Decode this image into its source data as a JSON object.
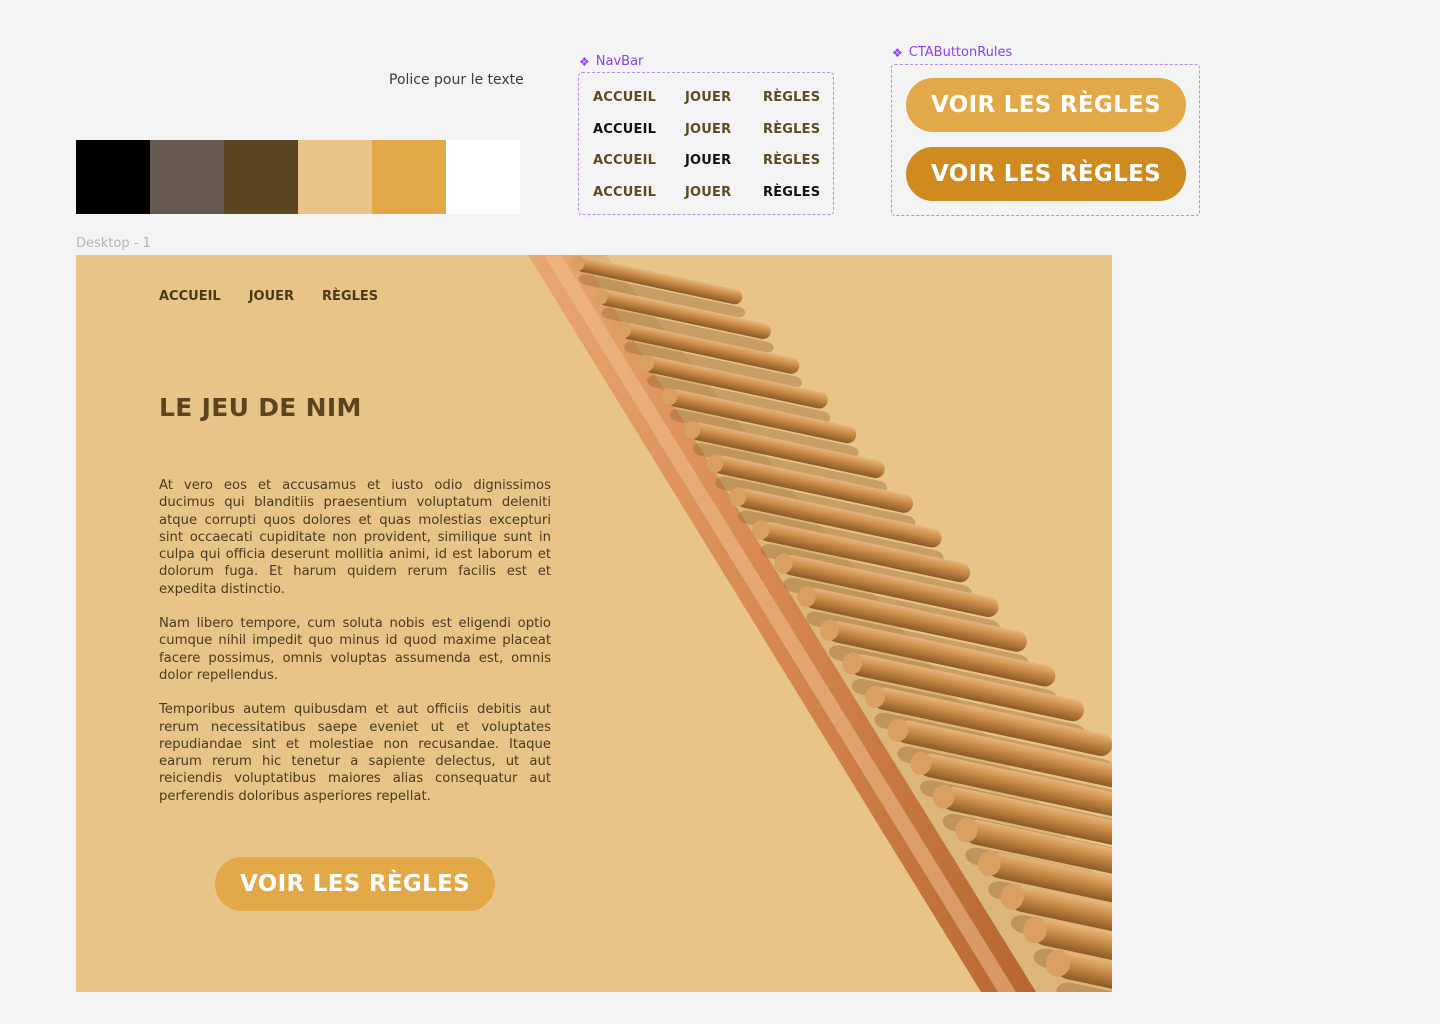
{
  "styleguide": {
    "font_note": "Police pour le texte",
    "palette": [
      "#000000",
      "#655a4f",
      "#5b4520",
      "#e8c488",
      "#e3a847",
      "#ffffff"
    ]
  },
  "navbar_component": {
    "label": "NavBar",
    "variants": [
      {
        "items": [
          "ACCUEIL",
          "JOUER",
          "RÈGLES"
        ],
        "active": null
      },
      {
        "items": [
          "ACCUEIL",
          "JOUER",
          "RÈGLES"
        ],
        "active": 0
      },
      {
        "items": [
          "ACCUEIL",
          "JOUER",
          "RÈGLES"
        ],
        "active": 1
      },
      {
        "items": [
          "ACCUEIL",
          "JOUER",
          "RÈGLES"
        ],
        "active": 2
      }
    ]
  },
  "cta_component": {
    "label": "CTAButtonRules",
    "variants": [
      "VOIR LES RÈGLES",
      "VOIR LES RÈGLES"
    ]
  },
  "frame": {
    "label": "Desktop - 1",
    "nav": [
      "ACCUEIL",
      "JOUER",
      "RÈGLES"
    ],
    "title": "LE JEU DE NIM",
    "paragraphs": [
      "At vero eos et accusamus et iusto odio dignissimos ducimus qui blanditiis praesentium voluptatum deleniti atque corrupti quos dolores et quas molestias excepturi sint occaecati cupiditate non provident, similique sunt in culpa qui officia deserunt mollitia animi, id est laborum et dolorum fuga. Et harum quidem rerum facilis est et expedita distinctio.",
      "Nam libero tempore, cum soluta nobis est eligendi optio cumque nihil impedit quo minus id quod maxime placeat facere possimus, omnis voluptas assumenda est, omnis dolor repellendus.",
      "Temporibus autem quibusdam et aut officiis debitis aut rerum necessitatibus saepe eveniet ut et voluptates repudiandae sint et molestiae non recusandae. Itaque earum rerum hic tenetur a sapiente delectus, ut aut reiciendis voluptatibus maiores alias consequatur aut perferendis doloribus asperiores repellat."
    ],
    "cta": "VOIR LES RÈGLES"
  },
  "icons": {
    "component": "component-diamond-icon"
  }
}
